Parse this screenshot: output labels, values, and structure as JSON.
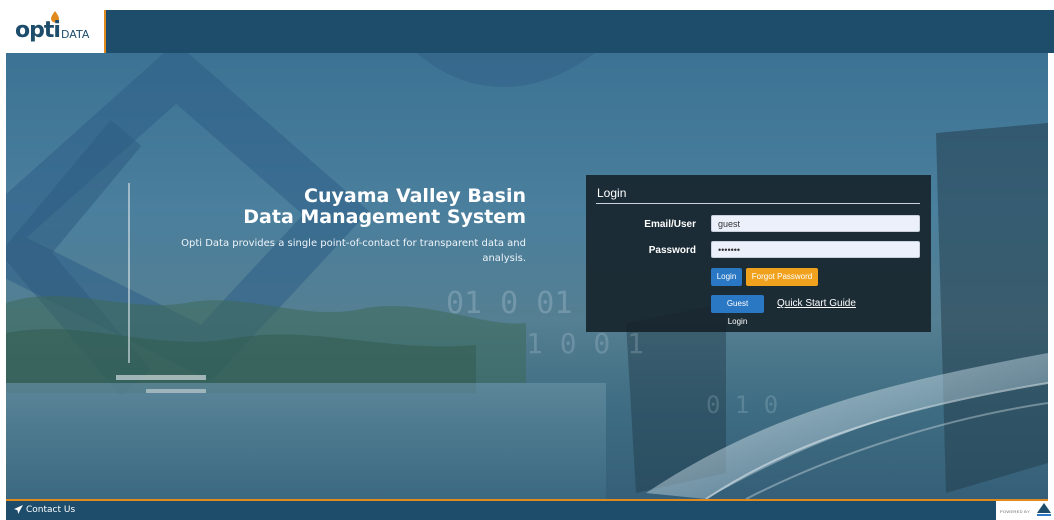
{
  "header": {
    "logo_primary": "opti",
    "logo_secondary": "DATA"
  },
  "hero": {
    "title_line1": "Cuyama Valley Basin",
    "title_line2": "Data Management System",
    "description": "Opti Data provides a single point-of-contact for transparent data and analysis."
  },
  "login": {
    "title": "Login",
    "email_label": "Email/User",
    "email_value": "guest",
    "password_label": "Password",
    "password_value": "•••••••",
    "login_button": "Login",
    "forgot_button": "Forgot Password",
    "guest_button": "Guest Login",
    "quick_start_link": "Quick Start Guide"
  },
  "footer": {
    "contact_label": "Contact Us",
    "powered_label": "POWERED BY"
  },
  "colors": {
    "brand_navy": "#1e4d6c",
    "accent_orange": "#e08a1e",
    "button_blue": "#2a77c4",
    "button_orange": "#f0a21e"
  },
  "icons": [
    "logo-drop-icon",
    "send-icon",
    "powered-by-logo-icon"
  ]
}
